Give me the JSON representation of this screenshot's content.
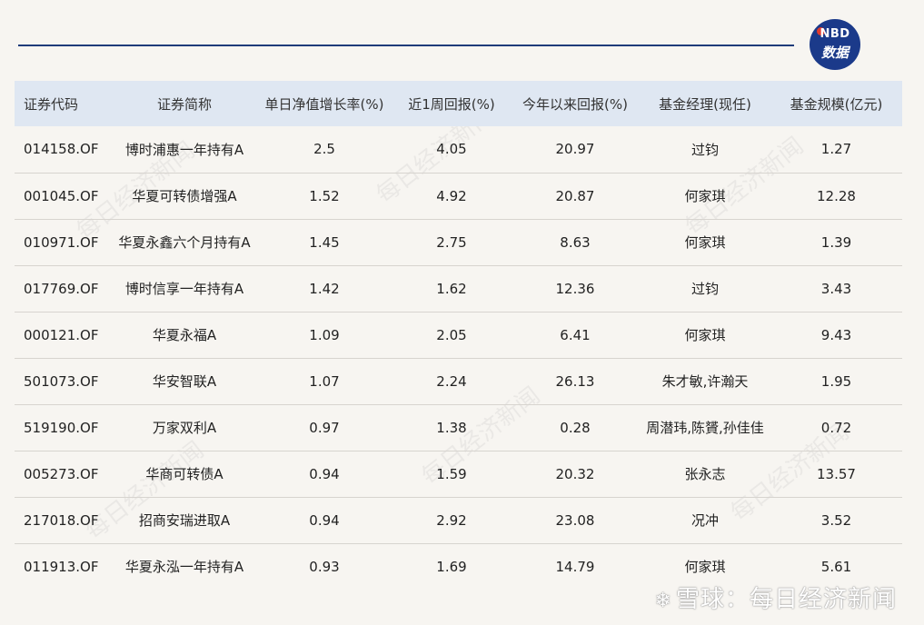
{
  "logo": {
    "line1": "NBD",
    "line2": "数据"
  },
  "table": {
    "headers": [
      "证券代码",
      "证券简称",
      "单日净值增长率(%)",
      "近1周回报(%)",
      "今年以来回报(%)",
      "基金经理(现任)",
      "基金规模(亿元)"
    ],
    "rows": [
      [
        "014158.OF",
        "博时浦惠一年持有A",
        "2.5",
        "4.05",
        "20.97",
        "过钧",
        "1.27"
      ],
      [
        "001045.OF",
        "华夏可转债增强A",
        "1.52",
        "4.92",
        "20.87",
        "何家琪",
        "12.28"
      ],
      [
        "010971.OF",
        "华夏永鑫六个月持有A",
        "1.45",
        "2.75",
        "8.63",
        "何家琪",
        "1.39"
      ],
      [
        "017769.OF",
        "博时信享一年持有A",
        "1.42",
        "1.62",
        "12.36",
        "过钧",
        "3.43"
      ],
      [
        "000121.OF",
        "华夏永福A",
        "1.09",
        "2.05",
        "6.41",
        "何家琪",
        "9.43"
      ],
      [
        "501073.OF",
        "华安智联A",
        "1.07",
        "2.24",
        "26.13",
        "朱才敏,许瀚天",
        "1.95"
      ],
      [
        "519190.OF",
        "万家双利A",
        "0.97",
        "1.38",
        "0.28",
        "周潜玮,陈贇,孙佳佳",
        "0.72"
      ],
      [
        "005273.OF",
        "华商可转债A",
        "0.94",
        "1.59",
        "20.32",
        "张永志",
        "13.57"
      ],
      [
        "217018.OF",
        "招商安瑞进取A",
        "0.94",
        "2.92",
        "23.08",
        "况冲",
        "3.52"
      ],
      [
        "011913.OF",
        "华夏永泓一年持有A",
        "0.93",
        "1.69",
        "14.79",
        "何家琪",
        "5.61"
      ]
    ]
  },
  "watermark": "每日经济新闻",
  "footer": {
    "text": "雪球：每日经济新闻"
  }
}
